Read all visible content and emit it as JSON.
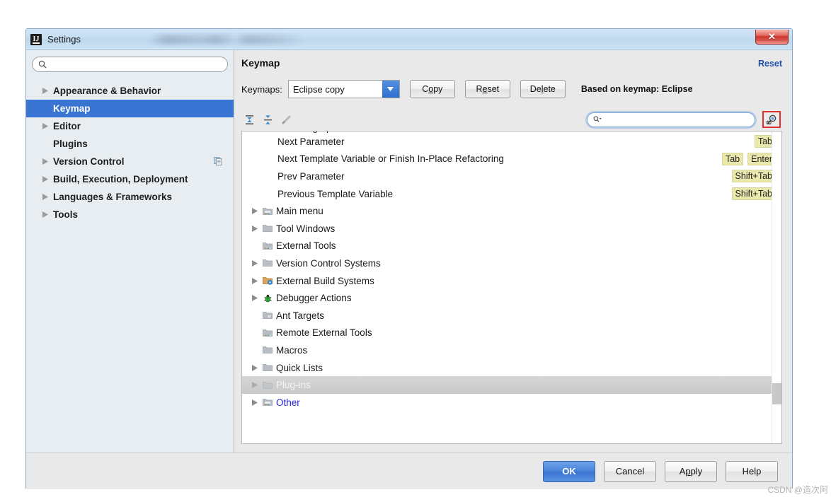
{
  "window": {
    "icon": "intellij-logo-icon",
    "title": "Settings",
    "close_label": "✕"
  },
  "sidebar": {
    "search": {
      "placeholder": "",
      "value": "",
      "icon": "search-icon"
    },
    "items": [
      {
        "label": "Appearance & Behavior",
        "expandable": true,
        "selected": false,
        "badge": false
      },
      {
        "label": "Keymap",
        "expandable": false,
        "selected": true,
        "badge": false
      },
      {
        "label": "Editor",
        "expandable": true,
        "selected": false,
        "badge": false
      },
      {
        "label": "Plugins",
        "expandable": false,
        "selected": false,
        "badge": false
      },
      {
        "label": "Version Control",
        "expandable": true,
        "selected": false,
        "badge": true
      },
      {
        "label": "Build, Execution, Deployment",
        "expandable": true,
        "selected": false,
        "badge": false
      },
      {
        "label": "Languages & Frameworks",
        "expandable": true,
        "selected": false,
        "badge": false
      },
      {
        "label": "Tools",
        "expandable": true,
        "selected": false,
        "badge": false
      }
    ]
  },
  "panel": {
    "title": "Keymap",
    "reset_link": "Reset",
    "keymaps_label": "Keymaps:",
    "keymap_selected": "Eclipse copy",
    "buttons": {
      "copy": {
        "pre": "C",
        "mnemonic": "o",
        "post": "py"
      },
      "reset": {
        "pre": "R",
        "mnemonic": "e",
        "post": "set"
      },
      "delete": {
        "pre": "De",
        "mnemonic": "l",
        "post": "ete"
      }
    },
    "based_on": "Based on keymap: Eclipse",
    "toolbar": {
      "expand_all": "expand-all-icon",
      "collapse_all": "collapse-all-icon",
      "edit": "edit-pencil-icon",
      "filter_placeholder": "",
      "filter_value": "",
      "filter_icon": "search-dropdown-icon",
      "find_by_shortcut": "find-by-shortcut-icon"
    }
  },
  "keymap_tree": {
    "rows": [
      {
        "type": "action",
        "label": "Fill Paragraph",
        "shortcuts": [],
        "clipped": true
      },
      {
        "type": "action",
        "label": "Next Parameter",
        "shortcuts": [
          "Tab"
        ]
      },
      {
        "type": "action",
        "label": "Next Template Variable or Finish In-Place Refactoring",
        "shortcuts": [
          "Tab",
          "Enter"
        ]
      },
      {
        "type": "action",
        "label": "Prev Parameter",
        "shortcuts": [
          "Shift+Tab"
        ]
      },
      {
        "type": "action",
        "label": "Previous Template Variable",
        "shortcuts": [
          "Shift+Tab"
        ]
      },
      {
        "type": "group",
        "label": "Main menu",
        "expandable": true,
        "icon": "folder-menu-icon"
      },
      {
        "type": "group",
        "label": "Tool Windows",
        "expandable": true,
        "icon": "folder-icon"
      },
      {
        "type": "group",
        "label": "External Tools",
        "expandable": false,
        "icon": "folder-tools-icon"
      },
      {
        "type": "group",
        "label": "Version Control Systems",
        "expandable": true,
        "icon": "folder-icon"
      },
      {
        "type": "group",
        "label": "External Build Systems",
        "expandable": true,
        "icon": "folder-build-icon"
      },
      {
        "type": "group",
        "label": "Debugger Actions",
        "expandable": true,
        "icon": "bug-icon"
      },
      {
        "type": "group",
        "label": "Ant Targets",
        "expandable": false,
        "icon": "folder-ant-icon"
      },
      {
        "type": "group",
        "label": "Remote External Tools",
        "expandable": false,
        "icon": "folder-tools-icon"
      },
      {
        "type": "group",
        "label": "Macros",
        "expandable": false,
        "icon": "folder-icon"
      },
      {
        "type": "group",
        "label": "Quick Lists",
        "expandable": true,
        "icon": "folder-icon"
      },
      {
        "type": "group",
        "label": "Plug-ins",
        "expandable": true,
        "icon": "folder-icon",
        "selected": true
      },
      {
        "type": "group",
        "label": "Other",
        "expandable": true,
        "icon": "folder-other-icon",
        "link": true
      }
    ]
  },
  "footer": {
    "ok": "OK",
    "cancel": "Cancel",
    "apply": {
      "pre": "A",
      "mnemonic": "p",
      "post": "ply"
    },
    "help": "Help"
  },
  "watermark": "CSDN @造次阿",
  "colors": {
    "selection_blue": "#3b75d4",
    "link_blue": "#2323dd",
    "badge_bg": "#e9e7ac",
    "highlight_red": "#e03131",
    "titlebar_blue": "#c5dcf1"
  }
}
